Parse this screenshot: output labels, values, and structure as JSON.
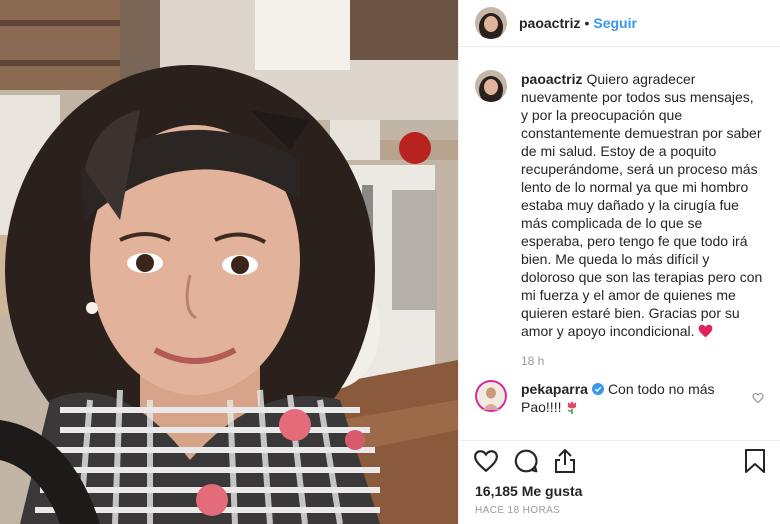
{
  "post": {
    "username": "paoactriz",
    "separator": "•",
    "follow_label": "Seguir"
  },
  "caption": {
    "username": "paoactriz",
    "text": "Quiero agradecer nuevamente por todos sus mensajes, y por la preocupación que constantemente demuestran por saber de mi salud. Estoy de a poquito recuperándome, será un proceso más lento de lo normal ya que mi hombro estaba muy dañado y la cirugía fue más complicada de lo que se esperaba, pero tengo fe que todo irá bien. Me queda lo más difícil y doloroso que son las terapias pero con mi fuerza y el amor de quienes me quieren estaré bien. Gracias por su amor y apoyo incondicional.",
    "emoji": "red-heart-icon",
    "time_ago": "18 h"
  },
  "comment": {
    "username": "pekaparra",
    "verified_icon": "verified-badge-icon",
    "text": "Con todo no más Pao!!!!",
    "emoji": "tulip-icon"
  },
  "actions": {
    "icons": [
      "heart-icon",
      "comment-icon",
      "share-icon",
      "bookmark-icon"
    ],
    "likes": "16,185 Me gusta",
    "posted": "HACE 18 HORAS"
  },
  "colors": {
    "link": "#3897f0",
    "muted": "#999999",
    "heart": "#ed4956",
    "verified": "#3897f0"
  }
}
